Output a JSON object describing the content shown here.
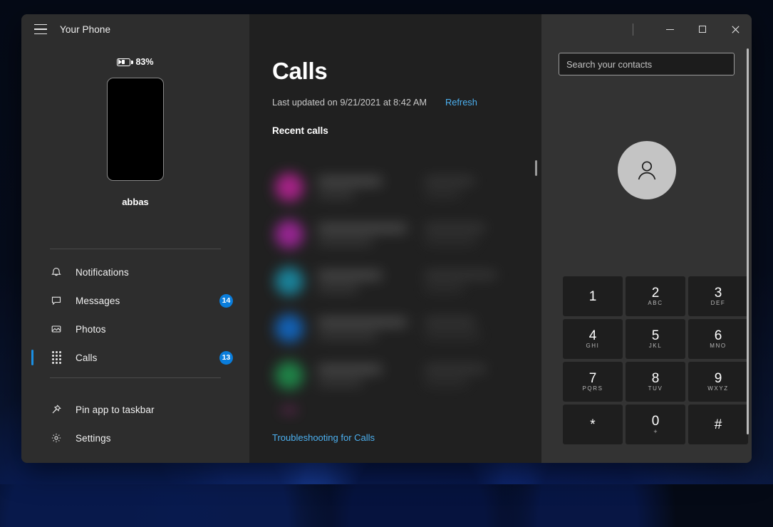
{
  "window": {
    "app_title": "Your Phone",
    "controls": {
      "minimize": "—",
      "maximize": "□",
      "close": "✕"
    }
  },
  "sidebar": {
    "battery": {
      "percent": "83%",
      "icon": "battery-charging-icon"
    },
    "device_name": "abbas",
    "nav_top": [
      {
        "label": "Notifications",
        "icon": "bell-icon",
        "badge": "",
        "selected": false
      },
      {
        "label": "Messages",
        "icon": "chat-icon",
        "badge": "14",
        "selected": false
      },
      {
        "label": "Photos",
        "icon": "photo-icon",
        "badge": "",
        "selected": false
      },
      {
        "label": "Calls",
        "icon": "dialpad-icon",
        "badge": "13",
        "selected": true
      }
    ],
    "nav_bottom": [
      {
        "label": "Pin app to taskbar",
        "icon": "pin-icon"
      },
      {
        "label": "Settings",
        "icon": "gear-icon"
      }
    ]
  },
  "main": {
    "title": "Calls",
    "last_updated": "Last updated on 9/21/2021 at 8:42 AM",
    "refresh_label": "Refresh",
    "section_title": "Recent calls",
    "troubleshoot_label": "Troubleshooting for Calls",
    "recent_calls": [
      {
        "avatar_color": "#b0238f"
      },
      {
        "avatar_color": "#a0269a"
      },
      {
        "avatar_color": "#1a8aa3"
      },
      {
        "avatar_color": "#1266c0"
      },
      {
        "avatar_color": "#1f8a4a"
      },
      {
        "avatar_color": "#b72f93"
      }
    ]
  },
  "dialer": {
    "search_placeholder": "Search your contacts",
    "search_value": "",
    "avatar_icon": "person-icon",
    "keys": [
      {
        "num": "1",
        "sub": ""
      },
      {
        "num": "2",
        "sub": "ABC"
      },
      {
        "num": "3",
        "sub": "DEF"
      },
      {
        "num": "4",
        "sub": "GHI"
      },
      {
        "num": "5",
        "sub": "JKL"
      },
      {
        "num": "6",
        "sub": "MNO"
      },
      {
        "num": "7",
        "sub": "PQRS"
      },
      {
        "num": "8",
        "sub": "TUV"
      },
      {
        "num": "9",
        "sub": "WXYZ"
      },
      {
        "num": "*",
        "sub": ""
      },
      {
        "num": "0",
        "sub": "+"
      },
      {
        "num": "#",
        "sub": ""
      }
    ]
  },
  "colors": {
    "accent": "#0a7ddb",
    "link": "#4cb0f0",
    "selection_bar": "#1a8fe3"
  }
}
